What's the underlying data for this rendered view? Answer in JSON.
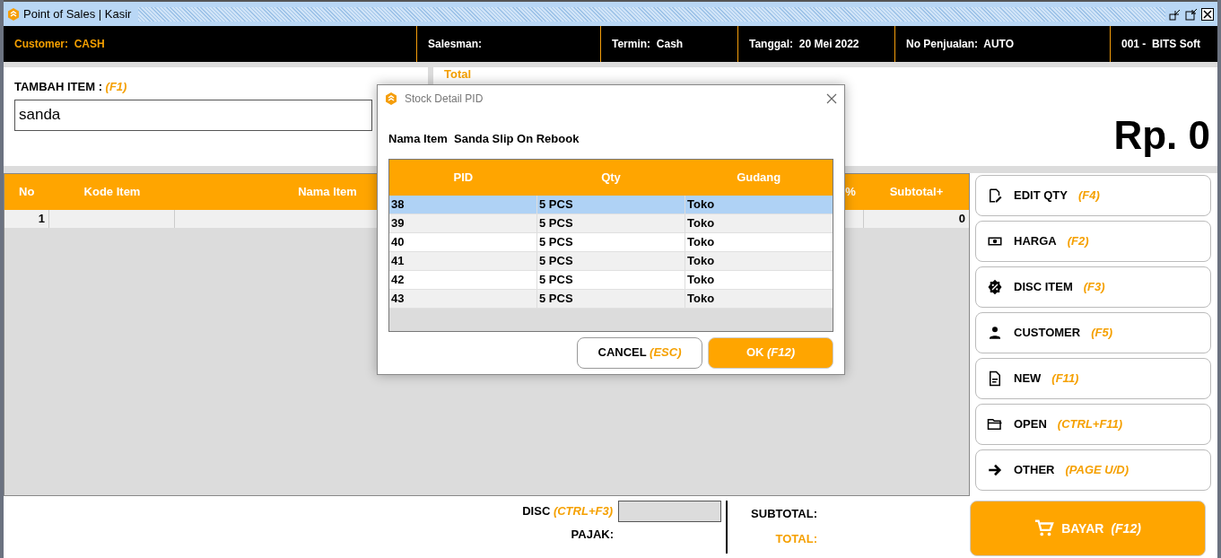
{
  "window": {
    "title": "Point of Sales | Kasir"
  },
  "info_bar": [
    {
      "label": "Customer:",
      "value": "CASH",
      "highlight": true
    },
    {
      "label": "Salesman:",
      "highlight": false
    },
    {
      "label": "Termin:",
      "value": "Cash",
      "highlight": false
    },
    {
      "label": "Tanggal:",
      "value": "20 Mei 2022",
      "highlight": false
    },
    {
      "label": "No Penjualan:",
      "value": "AUTO",
      "highlight": false
    },
    {
      "label": "001 -",
      "value": "BITS Soft",
      "highlight": false
    }
  ],
  "add_item": {
    "label": "TAMBAH ITEM :",
    "shortcut": "(F1)",
    "value": "sanda"
  },
  "total": {
    "label": "Total",
    "amount": "Rp. 0"
  },
  "table": {
    "columns": [
      "No",
      "Kode Item",
      "Nama Item",
      "",
      "%",
      "Subtotal+"
    ],
    "rows": [
      {
        "no": "1",
        "subtotal": "0"
      }
    ]
  },
  "actions": [
    {
      "label": "EDIT QTY",
      "shortcut": "(F4)"
    },
    {
      "label": "HARGA",
      "shortcut": "(F2)"
    },
    {
      "label": "DISC ITEM",
      "shortcut": "(F3)"
    },
    {
      "label": "CUSTOMER",
      "shortcut": "(F5)"
    },
    {
      "label": "NEW",
      "shortcut": "(F11)"
    },
    {
      "label": "OPEN",
      "shortcut": "(CTRL+F11)"
    },
    {
      "label": "OTHER",
      "shortcut": "(PAGE U/D)"
    }
  ],
  "footer": {
    "disc_label": "DISC",
    "disc_shortcut": "(CTRL+F3)",
    "tax_label": "PAJAK:",
    "subtotal_label": "SUBTOTAL:",
    "total_label": "TOTAL:"
  },
  "pay_button": {
    "label": "BAYAR",
    "shortcut": "(F12)"
  },
  "dialog": {
    "title": "Stock Detail PID",
    "item_label": "Nama Item",
    "item_name": "Sanda Slip On Rebook",
    "columns": [
      "PID",
      "Qty",
      "Gudang"
    ],
    "rows": [
      {
        "pid": "38",
        "qty": "5 PCS",
        "gudang": "Toko",
        "selected": true
      },
      {
        "pid": "39",
        "qty": "5 PCS",
        "gudang": "Toko",
        "selected": false
      },
      {
        "pid": "40",
        "qty": "5 PCS",
        "gudang": "Toko",
        "selected": false
      },
      {
        "pid": "41",
        "qty": "5 PCS",
        "gudang": "Toko",
        "selected": false
      },
      {
        "pid": "42",
        "qty": "5 PCS",
        "gudang": "Toko",
        "selected": false
      },
      {
        "pid": "43",
        "qty": "5 PCS",
        "gudang": "Toko",
        "selected": false
      }
    ],
    "cancel": {
      "label": "CANCEL",
      "shortcut": "(ESC)"
    },
    "ok": {
      "label": "OK",
      "shortcut": "(F12)"
    }
  }
}
